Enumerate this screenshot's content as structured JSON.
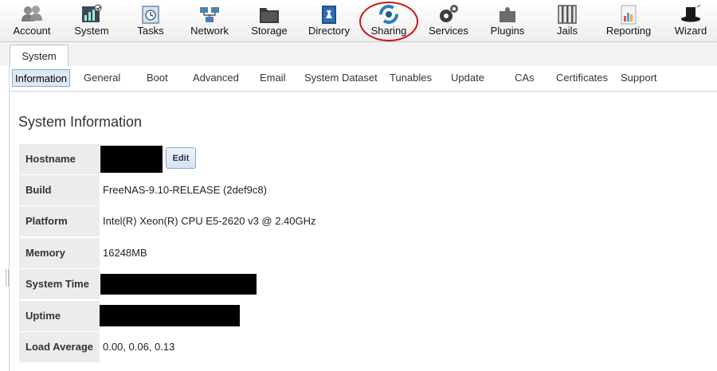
{
  "toolbar": {
    "items": [
      {
        "label": "Account",
        "icon": "users-icon"
      },
      {
        "label": "System",
        "icon": "system-monitor-icon"
      },
      {
        "label": "Tasks",
        "icon": "calendar-clock-icon"
      },
      {
        "label": "Network",
        "icon": "network-icon"
      },
      {
        "label": "Storage",
        "icon": "folder-icon"
      },
      {
        "label": "Directory",
        "icon": "directory-book-icon"
      },
      {
        "label": "Sharing",
        "icon": "sharing-icon"
      },
      {
        "label": "Services",
        "icon": "gears-icon"
      },
      {
        "label": "Plugins",
        "icon": "puzzle-icon"
      },
      {
        "label": "Jails",
        "icon": "jail-bars-icon"
      },
      {
        "label": "Reporting",
        "icon": "report-chart-icon"
      },
      {
        "label": "Wizard",
        "icon": "wizard-hat-icon"
      }
    ]
  },
  "main_tab": {
    "label": "System"
  },
  "subtabs": [
    "Information",
    "General",
    "Boot",
    "Advanced",
    "Email",
    "System Dataset",
    "Tunables",
    "Update",
    "CAs",
    "Certificates",
    "Support"
  ],
  "active_subtab": "Information",
  "section_title": "System Information",
  "info": {
    "hostname_label": "Hostname",
    "edit_label": "Edit",
    "build_label": "Build",
    "build_value": "FreeNAS-9.10-RELEASE (2def9c8)",
    "platform_label": "Platform",
    "platform_value": "Intel(R) Xeon(R) CPU E5-2620 v3 @ 2.40GHz",
    "memory_label": "Memory",
    "memory_value": "16248MB",
    "system_time_label": "System Time",
    "uptime_label": "Uptime",
    "load_label": "Load Average",
    "load_value": "0.00, 0.06, 0.13"
  },
  "colors": {
    "highlight_circle": "#d01414",
    "active_subtab_bg": "#dfe9f5",
    "label_bg": "#ececec",
    "redaction": "#000000"
  }
}
